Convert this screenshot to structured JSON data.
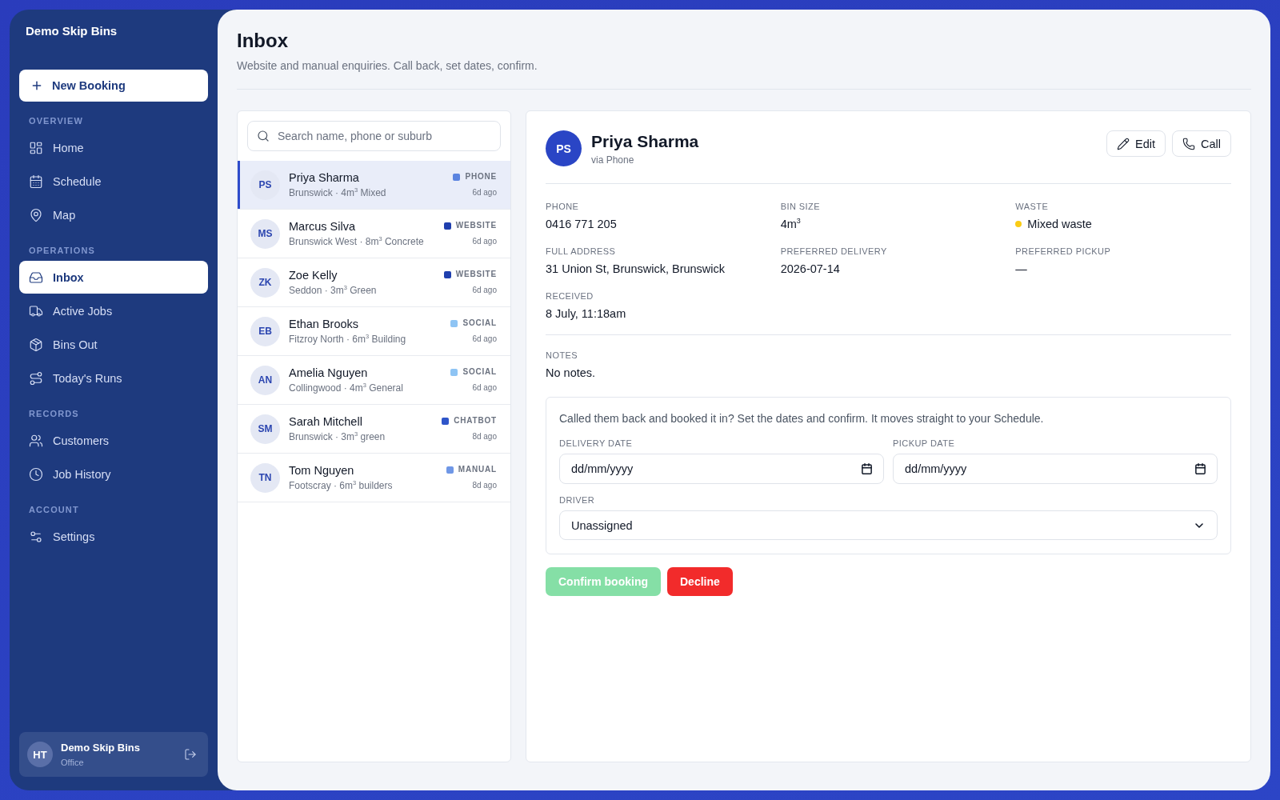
{
  "sidebar": {
    "brand": "Demo Skip Bins",
    "new_booking": "New Booking",
    "sections": [
      {
        "label": "OVERVIEW",
        "items": [
          {
            "label": "Home",
            "selected": false
          },
          {
            "label": "Schedule",
            "selected": false
          },
          {
            "label": "Map",
            "selected": false
          }
        ]
      },
      {
        "label": "OPERATIONS",
        "items": [
          {
            "label": "Inbox",
            "selected": true
          },
          {
            "label": "Active Jobs",
            "selected": false
          },
          {
            "label": "Bins Out",
            "selected": false
          },
          {
            "label": "Today's Runs",
            "selected": false
          }
        ]
      },
      {
        "label": "RECORDS",
        "items": [
          {
            "label": "Customers",
            "selected": false
          },
          {
            "label": "Job History",
            "selected": false
          }
        ]
      },
      {
        "label": "ACCOUNT",
        "items": [
          {
            "label": "Settings",
            "selected": false
          }
        ]
      }
    ],
    "user": {
      "initials": "HT",
      "name": "Demo Skip Bins",
      "role": "Office"
    }
  },
  "header": {
    "title": "Inbox",
    "subtitle": "Website and manual enquiries. Call back, set dates, confirm."
  },
  "enquiries": {
    "search": {
      "placeholder": "Search name, phone or suburb"
    },
    "rows": [
      {
        "initials": "PS",
        "name": "Priya Sharma",
        "details": "Brunswick · 4m$^{3}$ Mixed",
        "source": "PHONE",
        "color": "#5b84e0",
        "age": "6d ago",
        "selected": true
      },
      {
        "initials": "MS",
        "name": "Marcus Silva",
        "details": "Brunswick West · 8m$^{3}$ Concrete",
        "source": "WEBSITE",
        "color": "#1f3fae",
        "age": "6d ago",
        "selected": false
      },
      {
        "initials": "ZK",
        "name": "Zoe Kelly",
        "details": "Seddon · 3m$^{3}$ Green",
        "source": "WEBSITE",
        "color": "#1f3fae",
        "age": "6d ago",
        "selected": false
      },
      {
        "initials": "EB",
        "name": "Ethan Brooks",
        "details": "Fitzroy North · 6m$^{3}$ Building",
        "source": "SOCIAL",
        "color": "#8ec4f4",
        "age": "6d ago",
        "selected": false
      },
      {
        "initials": "AN",
        "name": "Amelia Nguyen",
        "details": "Collingwood · 4m$^{3}$ General",
        "source": "SOCIAL",
        "color": "#8ec4f4",
        "age": "6d ago",
        "selected": false
      },
      {
        "initials": "SM",
        "name": "Sarah Mitchell",
        "details": "Brunswick · 3m$^{3}$ green",
        "source": "CHATBOT",
        "color": "#2f55c9",
        "age": "8d ago",
        "selected": false
      },
      {
        "initials": "TN",
        "name": "Tom Nguyen",
        "details": "Footscray · 6m$^{3}$ builders",
        "source": "MANUAL",
        "color": "#6f97e6",
        "age": "8d ago",
        "selected": false
      }
    ]
  },
  "detail": {
    "initials": "PS",
    "name": "Priya Sharma",
    "via": "via Phone",
    "actions": [
      "Edit",
      "Call"
    ],
    "fields": [
      {
        "label": "PHONE",
        "value": "0416 771 205"
      },
      {
        "label": "BIN SIZE",
        "value": "4m$^{3}$"
      },
      {
        "label": "WASTE",
        "value": "Mixed waste",
        "color": "#facc15"
      },
      {
        "label": "FULL ADDRESS",
        "value": "31 Union St, Brunswick, Brunswick"
      },
      {
        "label": "PREFERRED DELIVERY",
        "value": "2026-07-14"
      },
      {
        "label": "PREFERRED PICKUP",
        "value": "—"
      },
      {
        "label": "RECEIVED",
        "value": "8 July, 11:18am"
      }
    ],
    "notes": {
      "label": "NOTES",
      "value": "No notes."
    },
    "booking": {
      "intro": "Called them back and booked it in? Set the dates and confirm. It moves straight to your Schedule.",
      "delivery_date": {
        "label": "DELIVERY DATE",
        "placeholder": "dd/mm/yyyy"
      },
      "pickup_date": {
        "label": "PICKUP DATE",
        "placeholder": "dd/mm/yyyy"
      },
      "driver": {
        "label": "DRIVER",
        "value": "Unassigned"
      }
    },
    "buttons": [
      {
        "label": "Confirm booking",
        "kind": "confirm",
        "disabled": true
      },
      {
        "label": "Decline",
        "kind": "decline",
        "disabled": false
      }
    ]
  }
}
